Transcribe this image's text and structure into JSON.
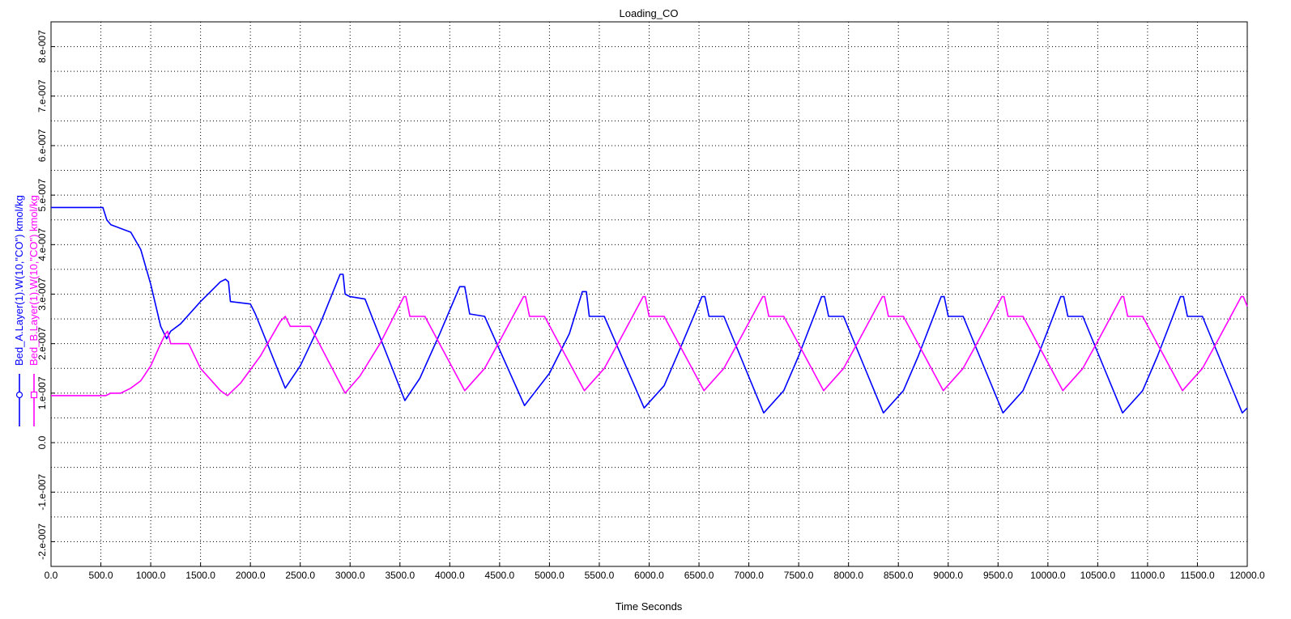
{
  "chart_data": {
    "type": "line",
    "title": "Loading_CO",
    "xlabel": "Time Seconds",
    "xlim": [
      0,
      12000
    ],
    "ylim": [
      -2.5e-07,
      8.5e-07
    ],
    "grid": true,
    "x_ticks": [
      0,
      500,
      1000,
      1500,
      2000,
      2500,
      3000,
      3500,
      4000,
      4500,
      5000,
      5500,
      6000,
      6500,
      7000,
      7500,
      8000,
      8500,
      9000,
      9500,
      10000,
      10500,
      11000,
      11500,
      12000
    ],
    "x_tick_labels": [
      "0.0",
      "500.0",
      "1000.0",
      "1500.0",
      "2000.0",
      "2500.0",
      "3000.0",
      "3500.0",
      "4000.0",
      "4500.0",
      "5000.0",
      "5500.0",
      "6000.0",
      "6500.0",
      "7000.0",
      "7500.0",
      "8000.0",
      "8500.0",
      "9000.0",
      "9500.0",
      "10000.0",
      "10500.0",
      "11000.0",
      "11500.0",
      "12000.0"
    ],
    "y_ticks": [
      -2e-07,
      -1e-07,
      0,
      1e-07,
      2e-07,
      3e-07,
      4e-07,
      5e-07,
      6e-07,
      7e-07,
      8e-07
    ],
    "y_tick_labels": [
      "-2.e-007",
      "-1.e-007",
      "0.0",
      "1.e-007",
      "2.e-007",
      "3.e-007",
      "4.e-007",
      "5.e-007",
      "6.e-007",
      "7.e-007",
      "8.e-007"
    ],
    "legend_placement": "left, vertical",
    "series": [
      {
        "name": "Bed_A.Layer(1).W(10,\"CO\") kmol/kg",
        "color": "#0000ff",
        "marker": "circle",
        "x": [
          0,
          520,
          560,
          600,
          800,
          900,
          1000,
          1100,
          1160,
          1200,
          1300,
          1500,
          1700,
          1750,
          1780,
          1800,
          2000,
          2050,
          2350,
          2500,
          2700,
          2900,
          2930,
          2950,
          3000,
          3150,
          3550,
          3700,
          3900,
          4100,
          4150,
          4200,
          4350,
          4750,
          5000,
          5200,
          5330,
          5370,
          5400,
          5550,
          5950,
          6150,
          6300,
          6530,
          6560,
          6600,
          6750,
          7150,
          7350,
          7500,
          7730,
          7760,
          7800,
          7950,
          8350,
          8550,
          8700,
          8930,
          8960,
          9000,
          9150,
          9550,
          9750,
          9900,
          10130,
          10160,
          10200,
          10350,
          10750,
          10950,
          11100,
          11330,
          11360,
          11400,
          11550,
          11950,
          12000
        ],
        "y": [
          4.75e-07,
          4.75e-07,
          4.5e-07,
          4.4e-07,
          4.25e-07,
          3.9e-07,
          3.2e-07,
          2.35e-07,
          2.1e-07,
          2.25e-07,
          2.4e-07,
          2.85e-07,
          3.25e-07,
          3.3e-07,
          3.25e-07,
          2.85e-07,
          2.8e-07,
          2.6e-07,
          1.1e-07,
          1.55e-07,
          2.4e-07,
          3.4e-07,
          3.4e-07,
          3e-07,
          2.95e-07,
          2.9e-07,
          8.5e-08,
          1.3e-07,
          2.2e-07,
          3.15e-07,
          3.15e-07,
          2.6e-07,
          2.55e-07,
          7.5e-08,
          1.4e-07,
          2.2e-07,
          3.05e-07,
          3.05e-07,
          2.55e-07,
          2.55e-07,
          7e-08,
          1.15e-07,
          1.85e-07,
          2.95e-07,
          2.95e-07,
          2.55e-07,
          2.55e-07,
          6e-08,
          1.05e-07,
          1.75e-07,
          2.95e-07,
          2.95e-07,
          2.55e-07,
          2.55e-07,
          6e-08,
          1.05e-07,
          1.75e-07,
          2.95e-07,
          2.95e-07,
          2.55e-07,
          2.55e-07,
          6e-08,
          1.05e-07,
          1.75e-07,
          2.95e-07,
          2.95e-07,
          2.55e-07,
          2.55e-07,
          6e-08,
          1.05e-07,
          1.75e-07,
          2.95e-07,
          2.95e-07,
          2.55e-07,
          2.55e-07,
          6e-08,
          7e-08
        ]
      },
      {
        "name": "Bed_B.Layer(1).W(10,\"CO\") kmol/kg",
        "color": "#ff00ff",
        "marker": "square",
        "x": [
          0,
          550,
          600,
          700,
          800,
          900,
          1000,
          1100,
          1150,
          1170,
          1200,
          1380,
          1500,
          1700,
          1770,
          1900,
          2100,
          2300,
          2350,
          2400,
          2600,
          2950,
          3100,
          3300,
          3540,
          3560,
          3600,
          3750,
          4150,
          4350,
          4500,
          4740,
          4760,
          4800,
          4950,
          5350,
          5550,
          5700,
          5940,
          5960,
          6000,
          6150,
          6550,
          6750,
          6900,
          7140,
          7160,
          7200,
          7350,
          7750,
          7950,
          8100,
          8340,
          8360,
          8400,
          8550,
          8950,
          9150,
          9300,
          9540,
          9560,
          9600,
          9750,
          10150,
          10350,
          10500,
          10740,
          10760,
          10800,
          10950,
          11350,
          11550,
          11700,
          11940,
          11960,
          12000
        ],
        "y": [
          9.5e-08,
          9.5e-08,
          1e-07,
          1e-07,
          1.1e-07,
          1.25e-07,
          1.55e-07,
          2e-07,
          2.2e-07,
          2.25e-07,
          2e-07,
          2e-07,
          1.5e-07,
          1.05e-07,
          9.5e-08,
          1.2e-07,
          1.75e-07,
          2.45e-07,
          2.55e-07,
          2.35e-07,
          2.35e-07,
          1e-07,
          1.35e-07,
          2e-07,
          2.95e-07,
          2.95e-07,
          2.55e-07,
          2.55e-07,
          1.05e-07,
          1.5e-07,
          2.05e-07,
          2.95e-07,
          2.95e-07,
          2.55e-07,
          2.55e-07,
          1.05e-07,
          1.5e-07,
          2.05e-07,
          2.95e-07,
          2.95e-07,
          2.55e-07,
          2.55e-07,
          1.05e-07,
          1.5e-07,
          2.05e-07,
          2.95e-07,
          2.95e-07,
          2.55e-07,
          2.55e-07,
          1.05e-07,
          1.5e-07,
          2.05e-07,
          2.95e-07,
          2.95e-07,
          2.55e-07,
          2.55e-07,
          1.05e-07,
          1.5e-07,
          2.05e-07,
          2.95e-07,
          2.95e-07,
          2.55e-07,
          2.55e-07,
          1.05e-07,
          1.5e-07,
          2.05e-07,
          2.95e-07,
          2.95e-07,
          2.55e-07,
          2.55e-07,
          1.05e-07,
          1.5e-07,
          2.05e-07,
          2.95e-07,
          2.95e-07,
          2.75e-07
        ]
      }
    ]
  }
}
